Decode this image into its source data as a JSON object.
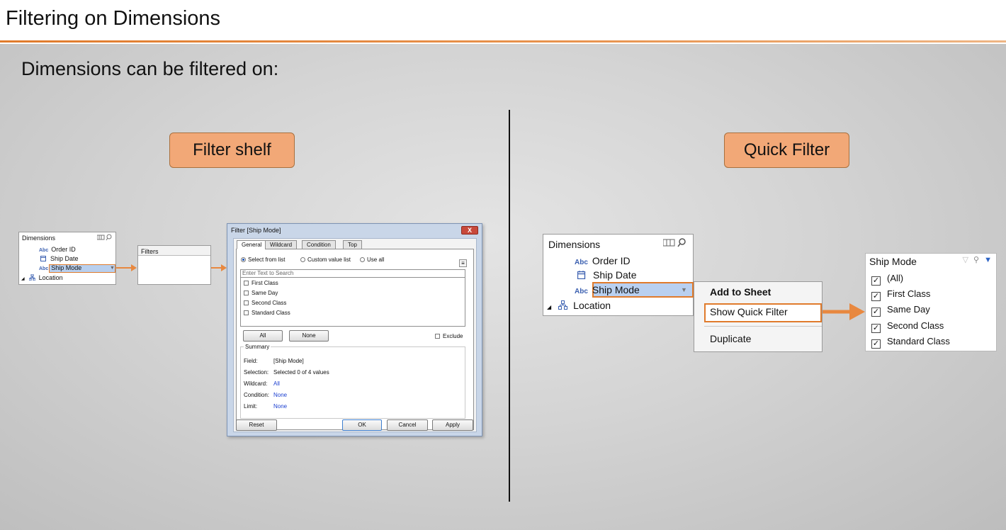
{
  "slide": {
    "title": "Filtering on Dimensions",
    "subtitle": "Dimensions can be filtered on:",
    "accent_color": "#e07b2c",
    "callout_color": "#f2a877"
  },
  "left": {
    "callout": "Filter shelf",
    "pane": {
      "header": "Dimensions",
      "items": [
        {
          "icon": "Abc",
          "label": "Order ID"
        },
        {
          "icon": "calendar-icon",
          "label": "Ship Date"
        },
        {
          "icon": "Abc",
          "label": "Ship Mode"
        },
        {
          "icon": "hierarchy-icon",
          "label": "Location"
        }
      ]
    },
    "filters_shelf": "Filters",
    "dialog": {
      "title": "Filter [Ship Mode]",
      "close": "X",
      "tabs": [
        "General",
        "Wildcard",
        "Condition",
        "Top"
      ],
      "radios": [
        "Select from list",
        "Custom value list",
        "Use all"
      ],
      "search_placeholder": "Enter Text to Search",
      "items": [
        "First Class",
        "Same Day",
        "Second Class",
        "Standard Class"
      ],
      "btn_all": "All",
      "btn_none": "None",
      "exclude": "Exclude",
      "summary_title": "Summary",
      "summary": {
        "field_k": "Field:",
        "field_v": "[Ship Mode]",
        "selection_k": "Selection:",
        "selection_v": "Selected 0 of 4 values",
        "wildcard_k": "Wildcard:",
        "wildcard_v": "All",
        "condition_k": "Condition:",
        "condition_v": "None",
        "limit_k": "Limit:",
        "limit_v": "None"
      },
      "btn_reset": "Reset",
      "btn_ok": "OK",
      "btn_cancel": "Cancel",
      "btn_apply": "Apply"
    }
  },
  "right": {
    "callout": "Quick Filter",
    "pane": {
      "header": "Dimensions",
      "items": [
        {
          "icon": "Abc",
          "label": "Order ID"
        },
        {
          "icon": "calendar-icon",
          "label": "Ship Date"
        },
        {
          "icon": "Abc",
          "label": "Ship Mode"
        },
        {
          "icon": "hierarchy-icon",
          "label": "Location"
        }
      ]
    },
    "context_menu": [
      "Add to Sheet",
      "Show Quick Filter",
      "Duplicate"
    ],
    "quick_filter": {
      "title": "Ship Mode",
      "items": [
        "(All)",
        "First Class",
        "Same Day",
        "Second Class",
        "Standard Class"
      ],
      "check": "✓"
    }
  }
}
